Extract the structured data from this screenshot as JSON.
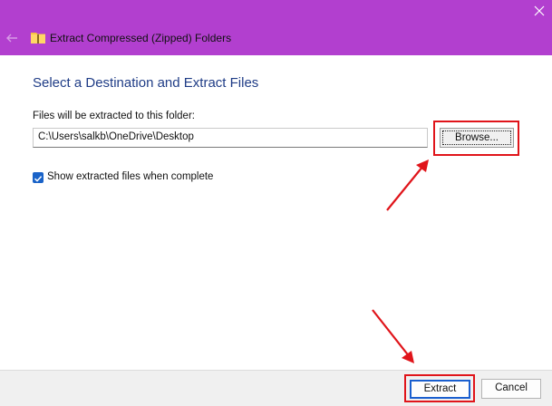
{
  "window": {
    "title": "Extract Compressed (Zipped) Folders",
    "titlebar_color": "#b23fcf"
  },
  "icons": {
    "back": "back-arrow-icon",
    "folder": "zip-folder-icon",
    "close": "close-icon"
  },
  "main": {
    "heading": "Select a Destination and Extract Files",
    "destination_label": "Files will be extracted to this folder:",
    "destination_path": "C:\\Users\\salkb\\OneDrive\\Desktop",
    "browse_label": "Browse...",
    "show_files_label": "Show extracted files when complete",
    "show_files_checked": true
  },
  "footer": {
    "extract_label": "Extract",
    "cancel_label": "Cancel"
  },
  "annotations": {
    "highlight_color": "#e0141a"
  }
}
